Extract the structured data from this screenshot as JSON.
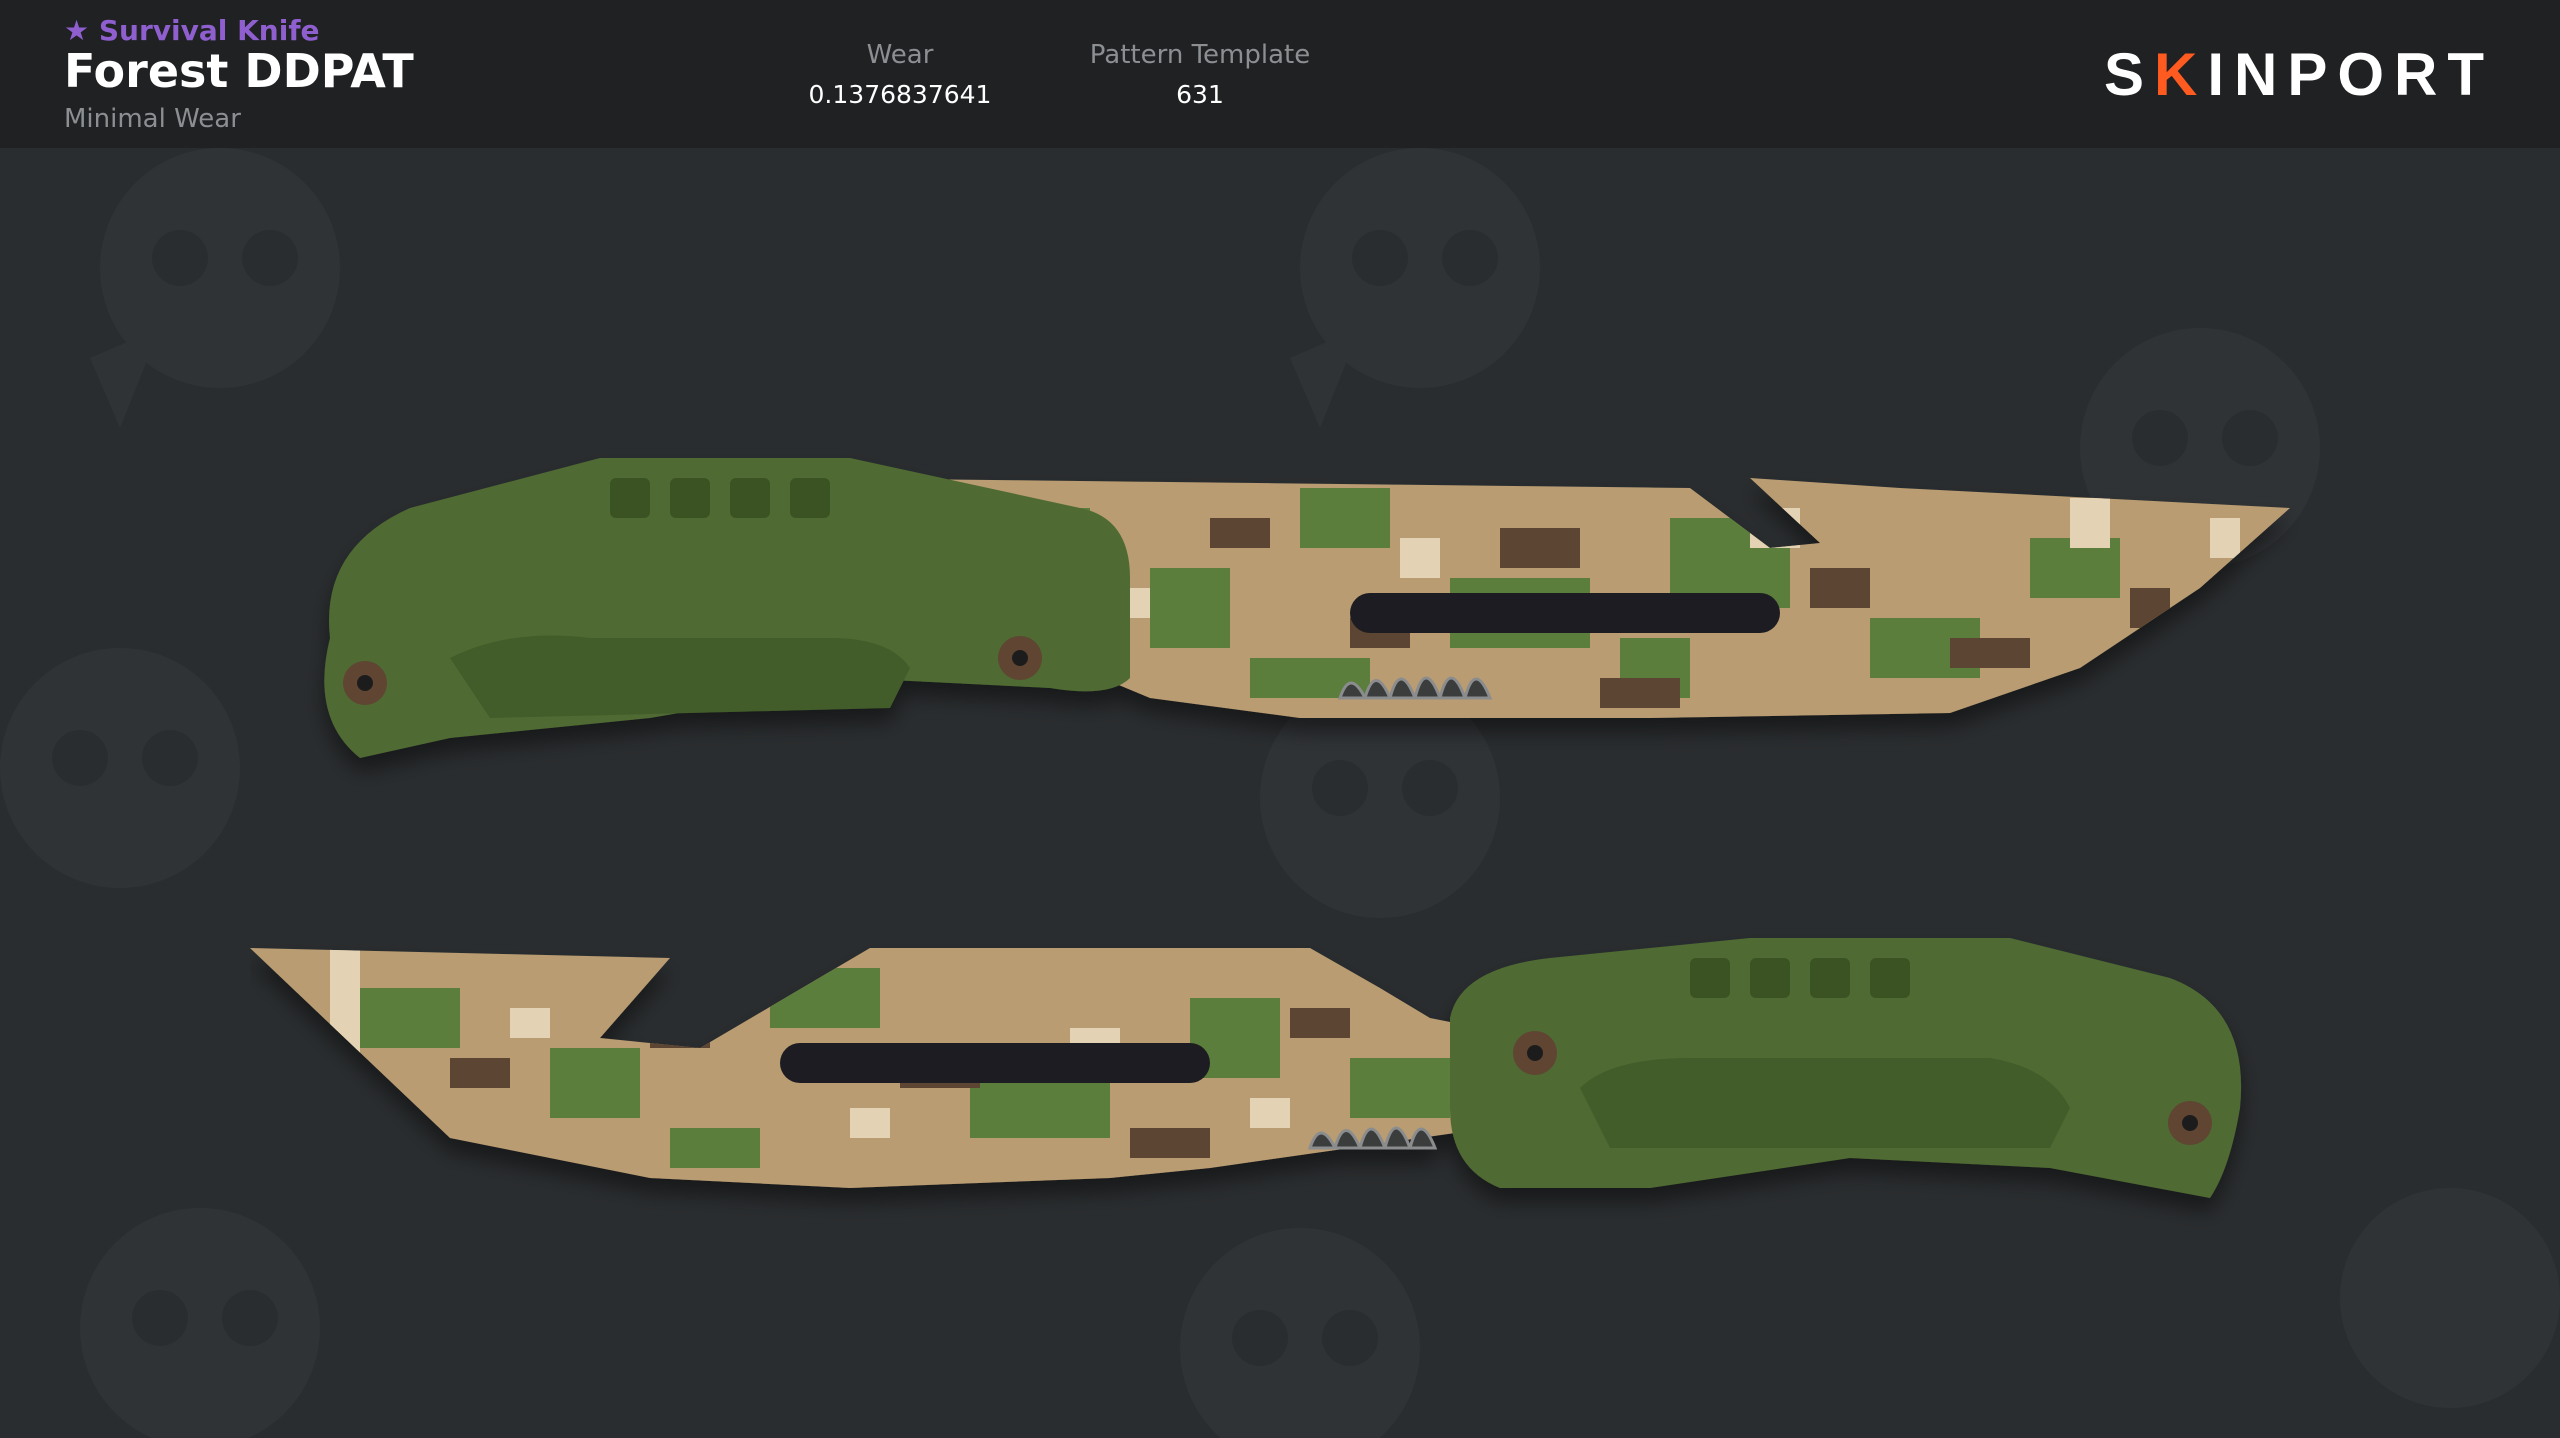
{
  "item": {
    "star_icon": "★",
    "type": "Survival Knife",
    "name": "Forest DDPAT",
    "exterior": "Minimal Wear"
  },
  "stats": {
    "wear_label": "Wear",
    "wear_value": "0.1376837641",
    "pattern_label": "Pattern Template",
    "pattern_value": "631"
  },
  "brand": {
    "logo_pre": "S",
    "logo_mid": "K",
    "logo_post": "INPORT",
    "accent": "#ff5a1f"
  },
  "colors": {
    "background": "#2a2d2f",
    "header": "#1f2123",
    "type_purple": "#8f5fd0",
    "handle_green": "#4f6b33",
    "camo_tan": "#b99c72",
    "camo_brown": "#5b4430",
    "camo_green": "#5c7e3c",
    "camo_cream": "#e3d3b4"
  },
  "views": [
    "knife-side-a",
    "knife-side-b"
  ]
}
